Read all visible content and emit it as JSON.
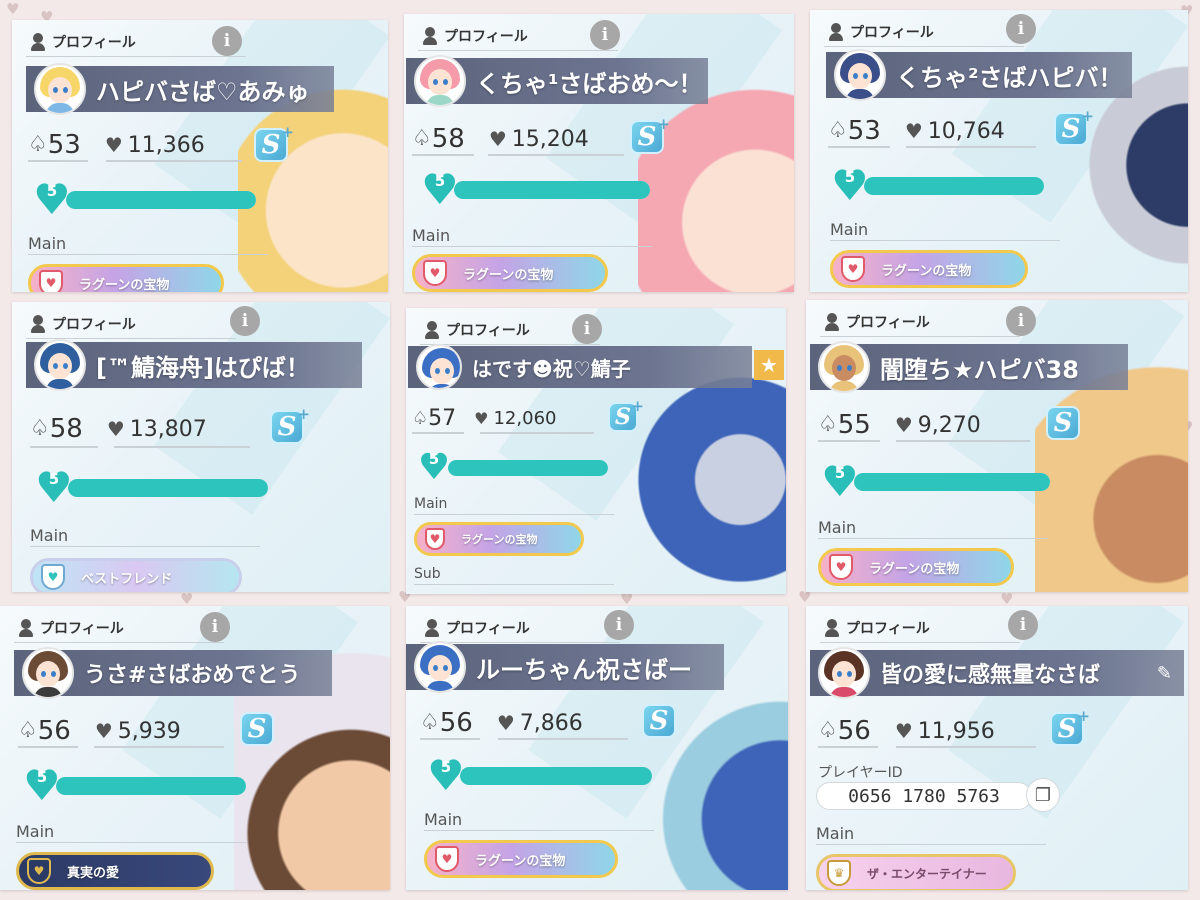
{
  "profile_label": "プロフィール",
  "info_label": "i",
  "icons": {
    "person": "person-icon",
    "info": "info-icon",
    "level": "spade-icon",
    "heart": "heart-icon",
    "rank": "rank-s-badge",
    "friend": "friend-heart-icon",
    "edit": "pencil-icon",
    "star": "star-icon",
    "copy": "copy-icon"
  },
  "level_icon_glyph": "♤",
  "heart_icon_glyph": "♥",
  "rank_letter": "S",
  "rank_plus": "+",
  "friend_level": "5",
  "star_glyph": "★",
  "edit_glyph": "✎",
  "copy_glyph": "❐",
  "main_label": "Main",
  "sub_label": "Sub",
  "colors": {
    "page_background": "#f4e9e9",
    "name_bar": "#5c647c",
    "friend_bar": "#2ec4be",
    "info_button": "#a7a7a7",
    "badge_border": "#f2c94c"
  },
  "cards": [
    {
      "name": "ハピバさば♡あみゅ",
      "level": "53",
      "likes": "11,366",
      "friend_progress": 1.0,
      "main_title": "ラグーンの宝物",
      "rank_plus": true
    },
    {
      "name": "くちゃ¹さばおめ〜！",
      "level": "58",
      "likes": "15,204",
      "friend_progress": 1.0,
      "main_title": "ラグーンの宝物",
      "rank_plus": true
    },
    {
      "name": "くちゃ²さばハピバ！",
      "level": "53",
      "likes": "10,764",
      "friend_progress": 1.0,
      "main_title": "ラグーンの宝物",
      "rank_plus": true
    },
    {
      "name": "[™鯖海舟]はぴば！",
      "level": "58",
      "likes": "13,807",
      "friend_progress": 1.0,
      "main_title": "ベストフレンド",
      "rank_plus": true
    },
    {
      "name": "はです☻祝♡鯖子",
      "level": "57",
      "likes": "12,060",
      "friend_progress": 1.0,
      "main_title": "ラグーンの宝物",
      "rank_plus": true,
      "sub_label_shown": true,
      "starred": true
    },
    {
      "name": "闇堕ち★ハピバ38",
      "level": "55",
      "likes": "9,270",
      "friend_progress": 1.0,
      "main_title": "ラグーンの宝物",
      "rank_plus": false
    },
    {
      "name": "うさ#さばおめでとう",
      "level": "56",
      "likes": "5,939",
      "friend_progress": 1.0,
      "main_title": "真実の愛",
      "rank_plus": false
    },
    {
      "name": "ルーちゃん祝さばー",
      "level": "56",
      "likes": "7,866",
      "friend_progress": 1.0,
      "main_title": "ラグーンの宝物",
      "rank_plus": false
    },
    {
      "name": "皆の愛に感無量なさば",
      "level": "56",
      "likes": "11,956",
      "friend_progress": 1.0,
      "main_title": "ザ・エンターテイナー",
      "rank_plus": true,
      "player_id_label": "プレイヤーID",
      "player_id": "0656 1780 5763"
    }
  ]
}
